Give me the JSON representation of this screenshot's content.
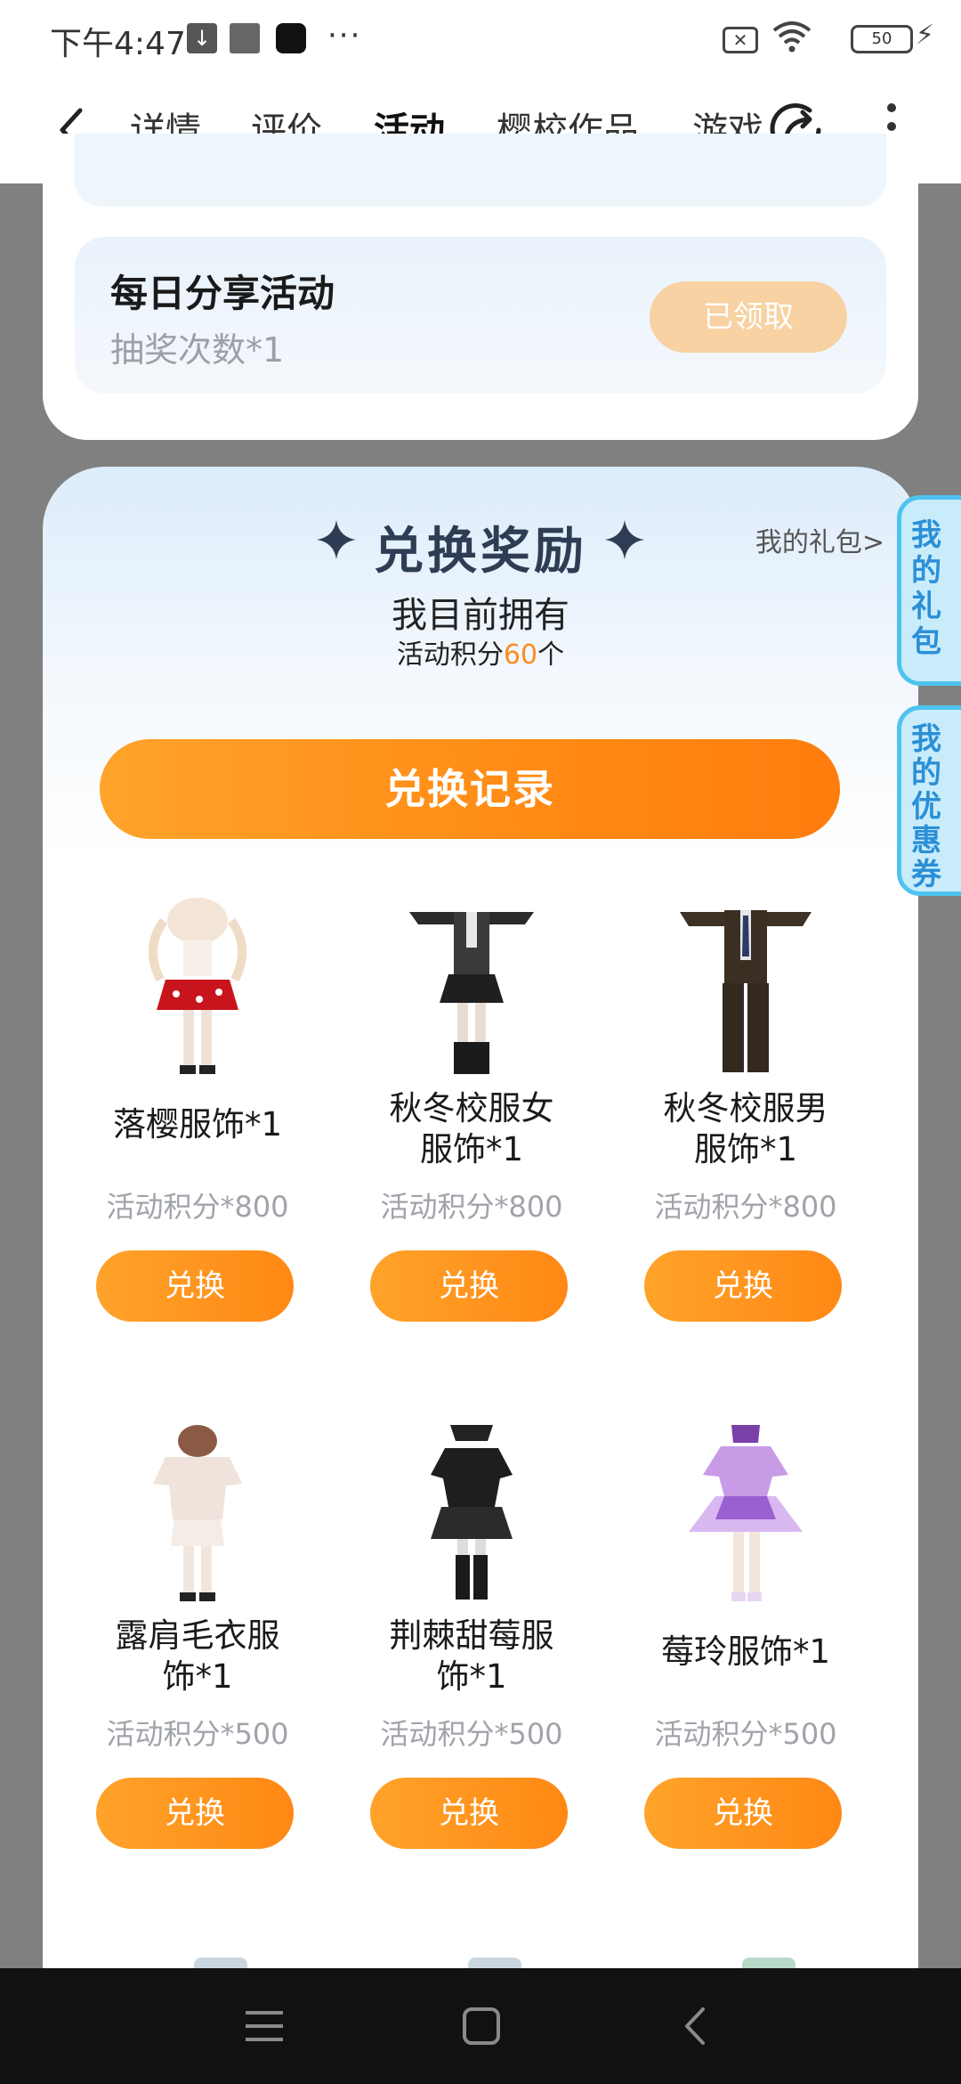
{
  "status_bar": {
    "time": "下午4:47",
    "battery": "50",
    "icons": [
      "download-icon",
      "app-icon",
      "app-icon",
      "more-icon",
      "sim-off-icon",
      "wifi-icon",
      "battery-icon",
      "charging-icon"
    ]
  },
  "nav": {
    "tabs": [
      {
        "label": "详情"
      },
      {
        "label": "评价"
      },
      {
        "label": "活动"
      },
      {
        "label": "樱校作品"
      },
      {
        "label": "游戏"
      }
    ],
    "active_tab": "活动",
    "accent": "#ff8a1a"
  },
  "daily_task": {
    "title": "每日分享活动",
    "reward": "抽奖次数*1",
    "button": "已领取"
  },
  "exchange": {
    "title": "兑换奖励",
    "my_gift_link": "我的礼包>",
    "own_label": "我目前拥有",
    "points_prefix": "活动积分",
    "points_value": "60",
    "points_suffix": "个",
    "record_button": "兑换记录",
    "items": [
      {
        "name_line1": "落樱服饰*1",
        "name_line2": "",
        "cost": "活动积分*800",
        "button": "兑换"
      },
      {
        "name_line1": "秋冬校服女",
        "name_line2": "服饰*1",
        "cost": "活动积分*800",
        "button": "兑换"
      },
      {
        "name_line1": "秋冬校服男",
        "name_line2": "服饰*1",
        "cost": "活动积分*800",
        "button": "兑换"
      },
      {
        "name_line1": "露肩毛衣服",
        "name_line2": "饰*1",
        "cost": "活动积分*500",
        "button": "兑换"
      },
      {
        "name_line1": "荆棘甜莓服",
        "name_line2": "饰*1",
        "cost": "活动积分*500",
        "button": "兑换"
      },
      {
        "name_line1": "莓玲服饰*1",
        "name_line2": "",
        "cost": "活动积分*500",
        "button": "兑换"
      }
    ]
  },
  "side_tabs": {
    "gift": "我的礼包",
    "coupon": "我的优惠券"
  }
}
